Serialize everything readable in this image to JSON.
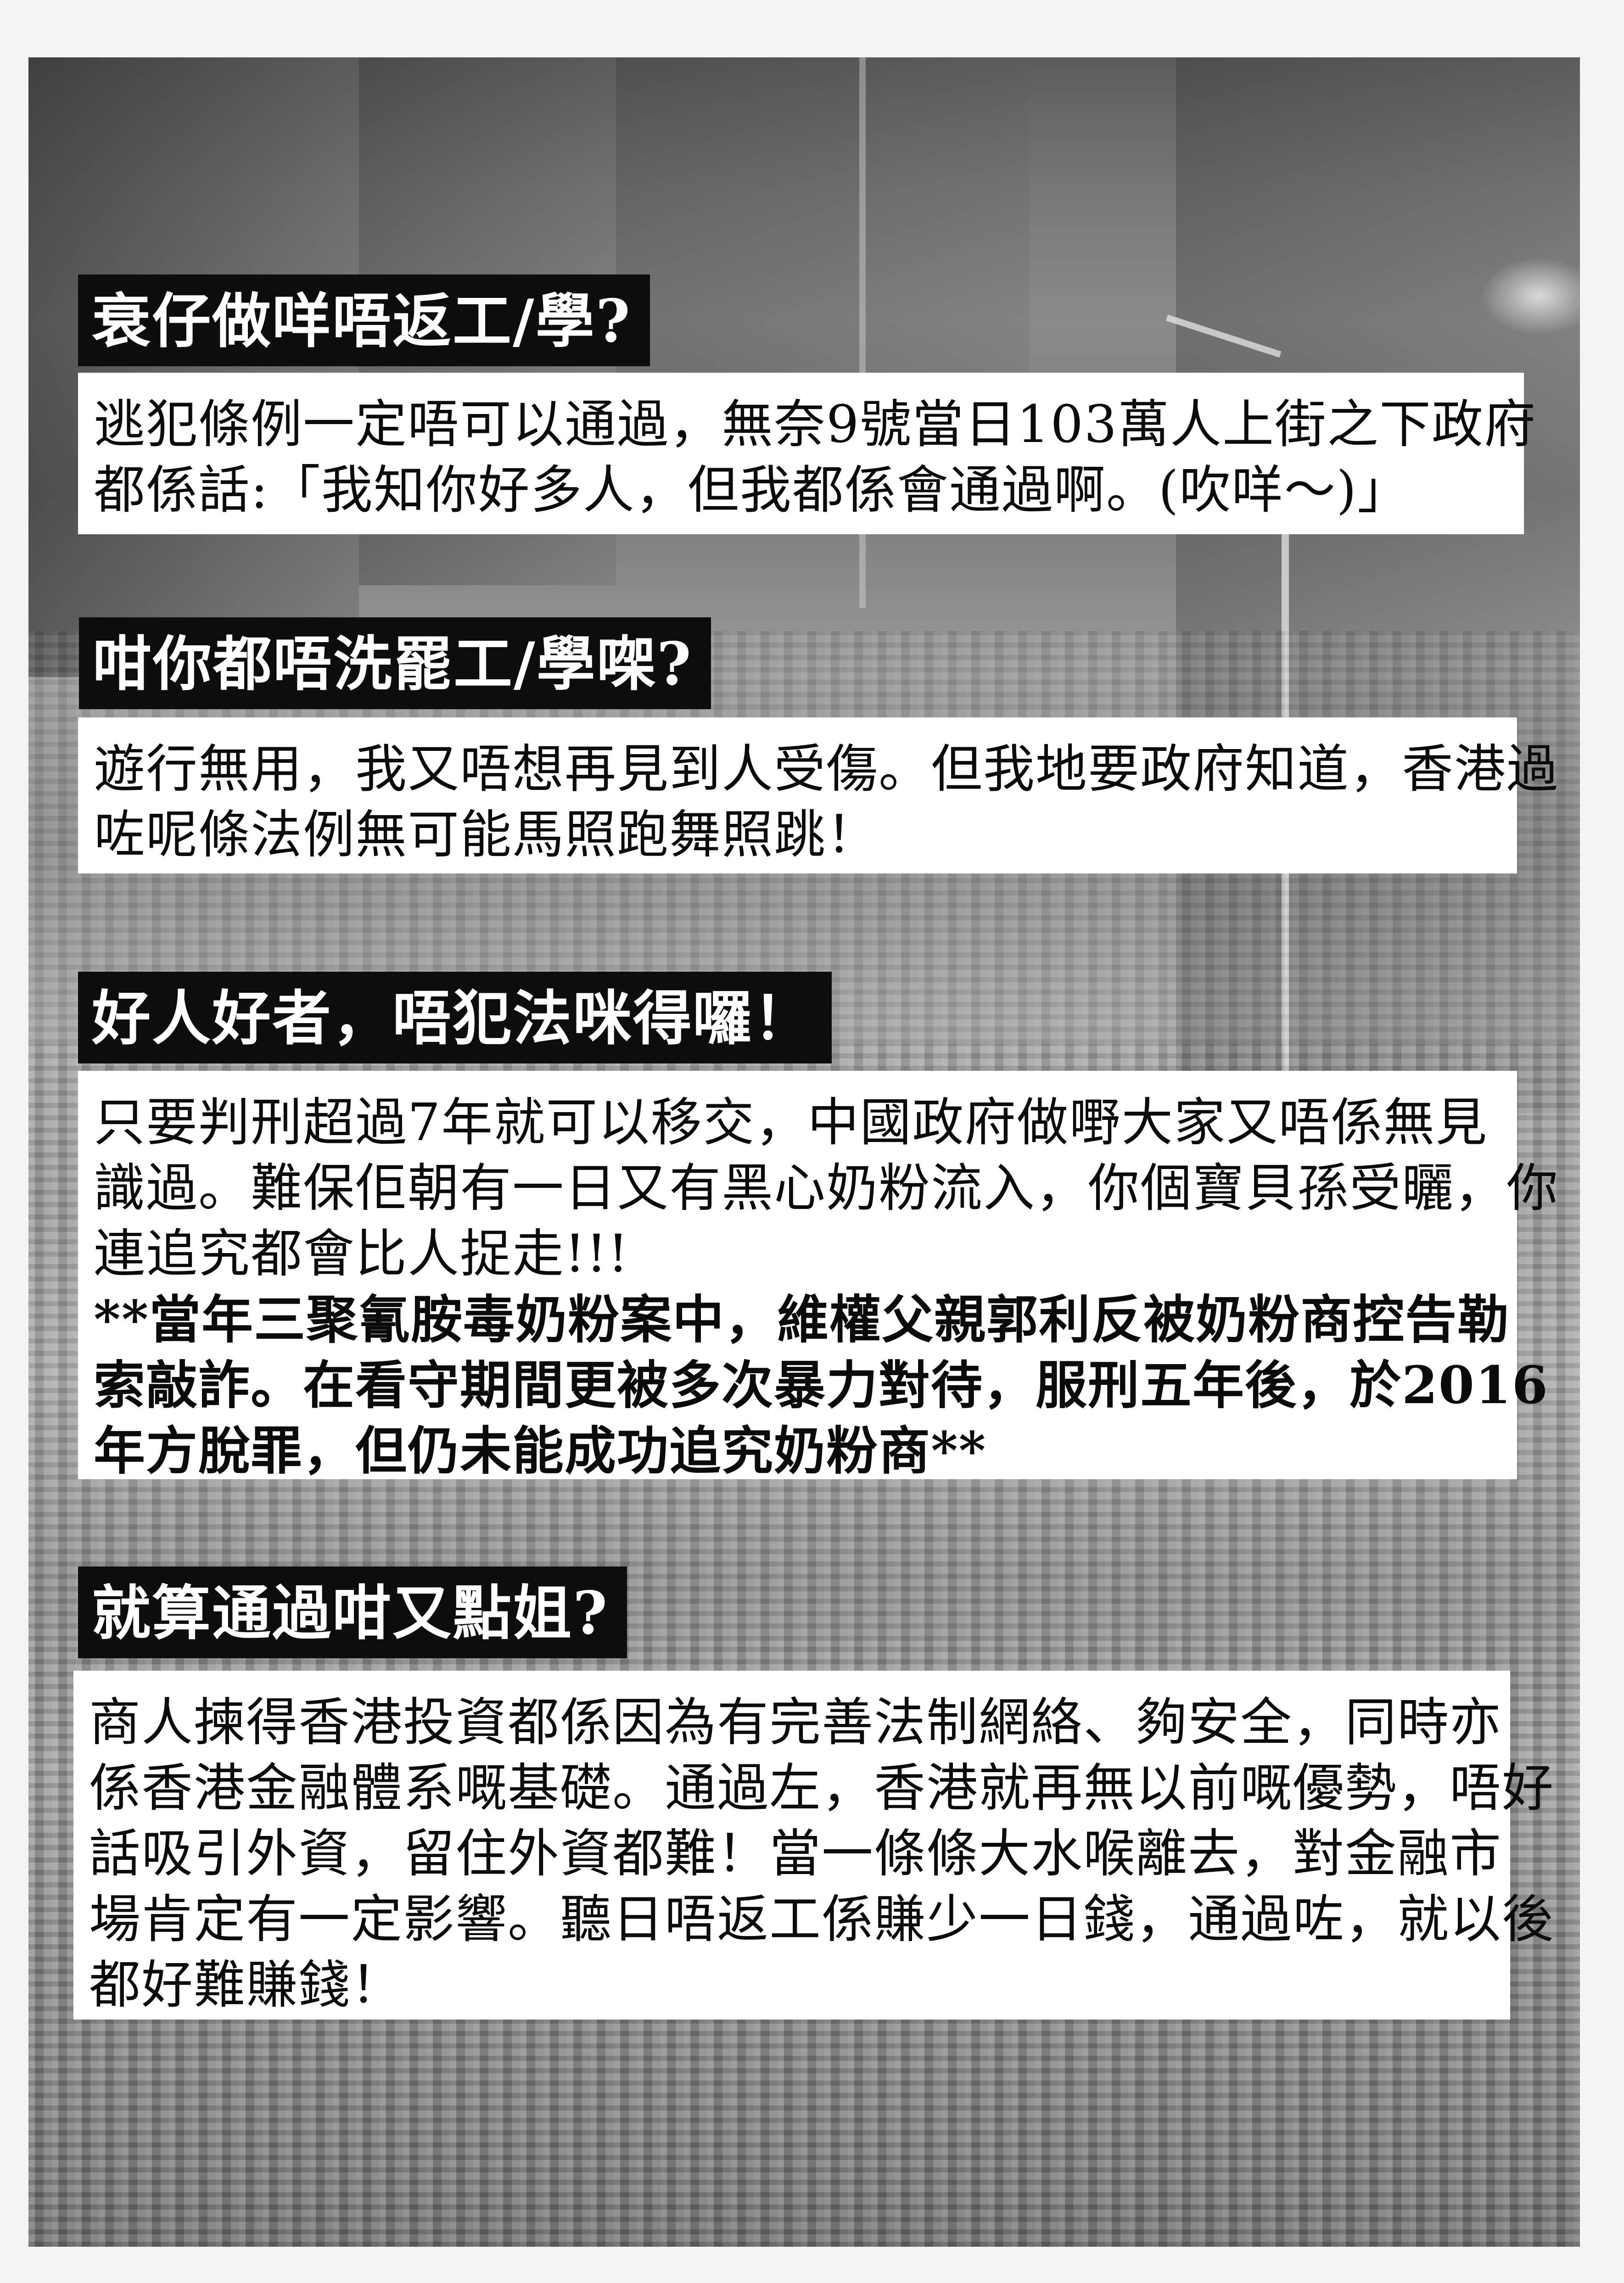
{
  "sections": [
    {
      "heading": "衰仔做咩唔返工/學?",
      "body_lines": [
        "逃犯條例一定唔可以通過，無奈9號當日103萬人上街之下政府",
        "都係話:「我知你好多人，但我都係會通過啊。(吹咩～)」"
      ]
    },
    {
      "heading": "咁你都唔洗罷工/學㗎?",
      "body_lines": [
        "遊行無用，我又唔想再見到人受傷。但我地要政府知道，香港過",
        "咗呢條法例無可能馬照跑舞照跳！"
      ]
    },
    {
      "heading": "好人好者，唔犯法咪得囉！",
      "body_lines": [
        "只要判刑超過7年就可以移交，中國政府做嘢大家又唔係無見",
        "識過。難保佢朝有一日又有黑心奶粉流入，你個寶貝孫受曬，你",
        "連追究都會比人捉走!!!"
      ],
      "note_lines": [
        "**當年三聚氰胺毒奶粉案中，維權父親郭利反被奶粉商控告勒",
        "索敲詐。在看守期間更被多次暴力對待，服刑五年後，於2016",
        "年方脫罪，但仍未能成功追究奶粉商**"
      ]
    },
    {
      "heading": "就算通過咁又點姐?",
      "body_lines": [
        "商人揀得香港投資都係因為有完善法制網絡、夠安全，同時亦",
        "係香港金融體系嘅基礎。通過左，香港就再無以前嘅優勢，唔好",
        "話吸引外資，留住外資都難！當一條條大水喉離去，對金融市",
        "場肯定有一定影響。聽日唔返工係賺少一日錢，通過咗，就以後",
        "都好難賺錢！"
      ]
    }
  ]
}
